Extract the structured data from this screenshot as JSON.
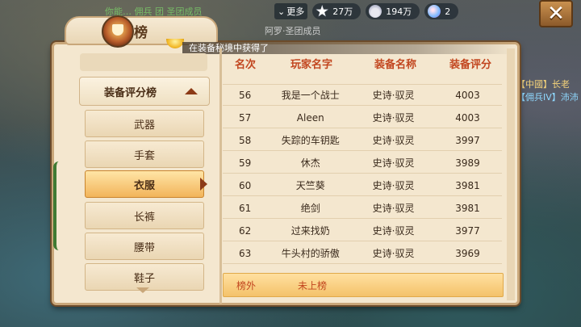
{
  "scene": {
    "chat_line": "你能… 佣兵 团 圣团成员",
    "chat_line2": "阿罗·圣团成员",
    "right_chat": [
      "【中國】长老",
      "【佣兵IV】沛沛"
    ]
  },
  "topbar": {
    "more_label": "更多",
    "stars": "27万",
    "shells": "194万",
    "gems": "2"
  },
  "panel": {
    "title": "排行榜",
    "notice_prefix": "在装备秘境中获得了",
    "category_header": "装备评分榜",
    "menu_items": [
      "武器",
      "手套",
      "衣服",
      "长裤",
      "腰带",
      "鞋子"
    ],
    "selected_item": "衣服"
  },
  "table": {
    "headers": [
      "名次",
      "玩家名字",
      "装备名称",
      "装备评分"
    ],
    "rows": [
      {
        "rank": "56",
        "name": "我是一个战士",
        "equip": "史诗·驭灵",
        "score": "4003"
      },
      {
        "rank": "57",
        "name": "Aleen",
        "equip": "史诗·驭灵",
        "score": "4003"
      },
      {
        "rank": "58",
        "name": "失踪的车钥匙",
        "equip": "史诗·驭灵",
        "score": "3997"
      },
      {
        "rank": "59",
        "name": "休杰",
        "equip": "史诗·驭灵",
        "score": "3989"
      },
      {
        "rank": "60",
        "name": "天竺葵",
        "equip": "史诗·驭灵",
        "score": "3981"
      },
      {
        "rank": "61",
        "name": "绝剑",
        "equip": "史诗·驭灵",
        "score": "3981"
      },
      {
        "rank": "62",
        "name": "过来找奶",
        "equip": "史诗·驭灵",
        "score": "3977"
      },
      {
        "rank": "63",
        "name": "牛头村的骄傲",
        "equip": "史诗·驭灵",
        "score": "3969"
      }
    ],
    "my_rank": "榜外",
    "my_status": "未上榜"
  }
}
